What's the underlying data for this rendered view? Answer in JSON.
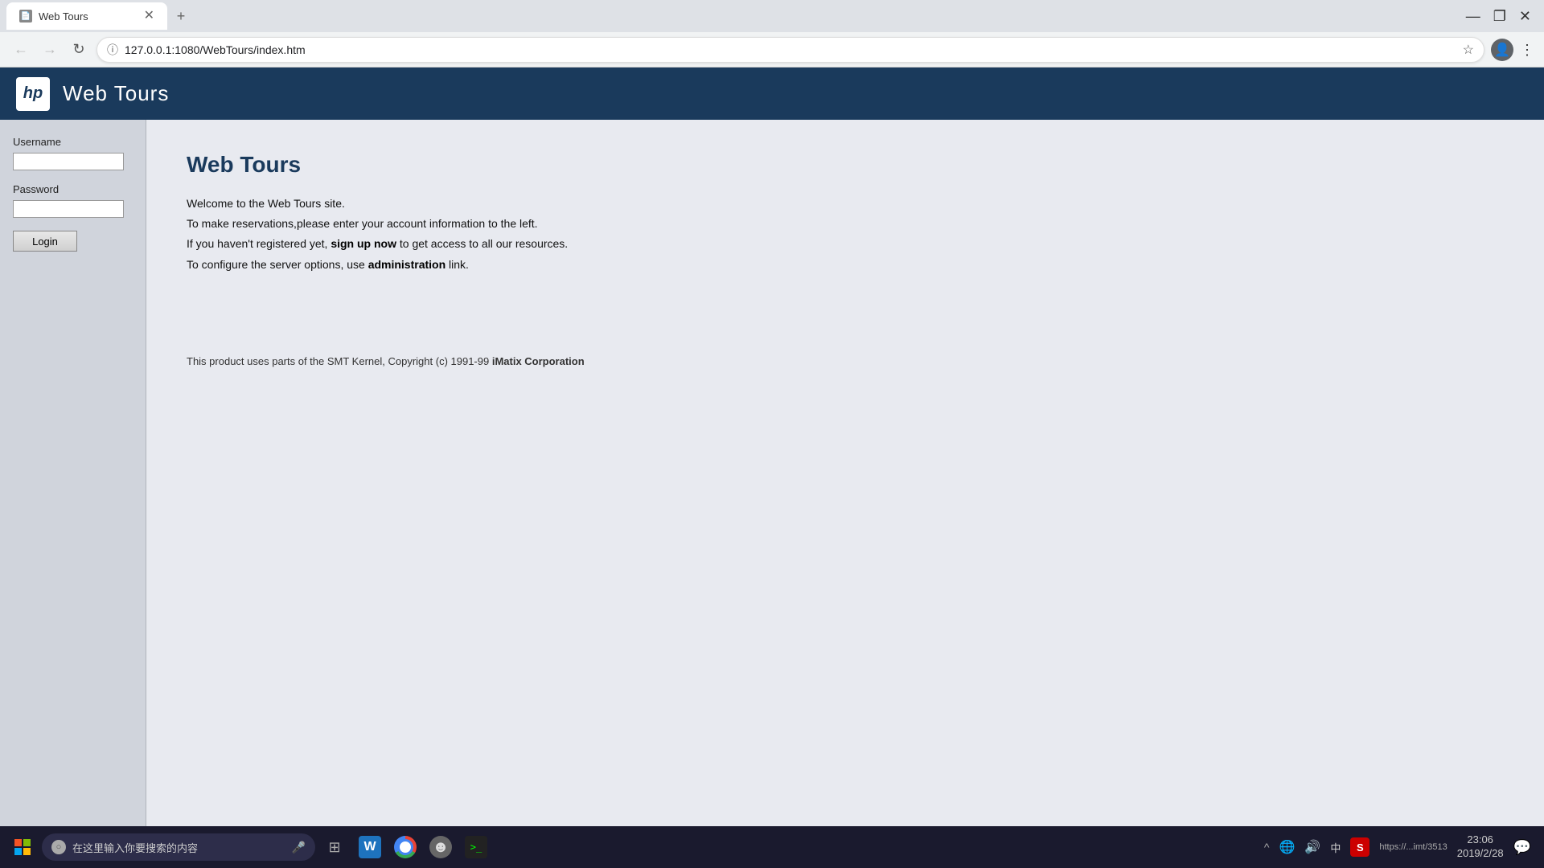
{
  "browser": {
    "tab_title": "Web Tours",
    "tab_new_label": "+",
    "address": "127.0.0.1:1080/WebTours/index.htm",
    "back_btn": "‹",
    "forward_btn": "›",
    "reload_btn": "↻",
    "star_icon": "☆",
    "menu_icon": "⋮",
    "close_icon": "✕",
    "minimize_icon": "—",
    "maximize_icon": "❐",
    "user_icon": "👤"
  },
  "site": {
    "header_title": "Web Tours",
    "logo_text": "hp"
  },
  "sidebar": {
    "username_label": "Username",
    "password_label": "Password",
    "login_button": "Login",
    "username_value": "",
    "password_value": ""
  },
  "content": {
    "heading": "Web Tours",
    "para1": "Welcome to the Web Tours site.",
    "para2": "To make reservations,please enter your account information to the left.",
    "para3_before": "If you haven't registered yet, ",
    "para3_link": "sign up now",
    "para3_after": " to get access to all our resources.",
    "para4_before": "To configure the server options, use ",
    "para4_link": "administration",
    "para4_after": " link.",
    "footer": "This product uses parts of the SMT Kernel, Copyright (c) 1991-99 ",
    "footer_bold": "iMatix Corporation"
  },
  "taskbar": {
    "search_placeholder": "在这里输入你要搜索的内容",
    "time": "23:06",
    "date": "2019/2/28",
    "url_preview": "https://...imt/3513"
  }
}
